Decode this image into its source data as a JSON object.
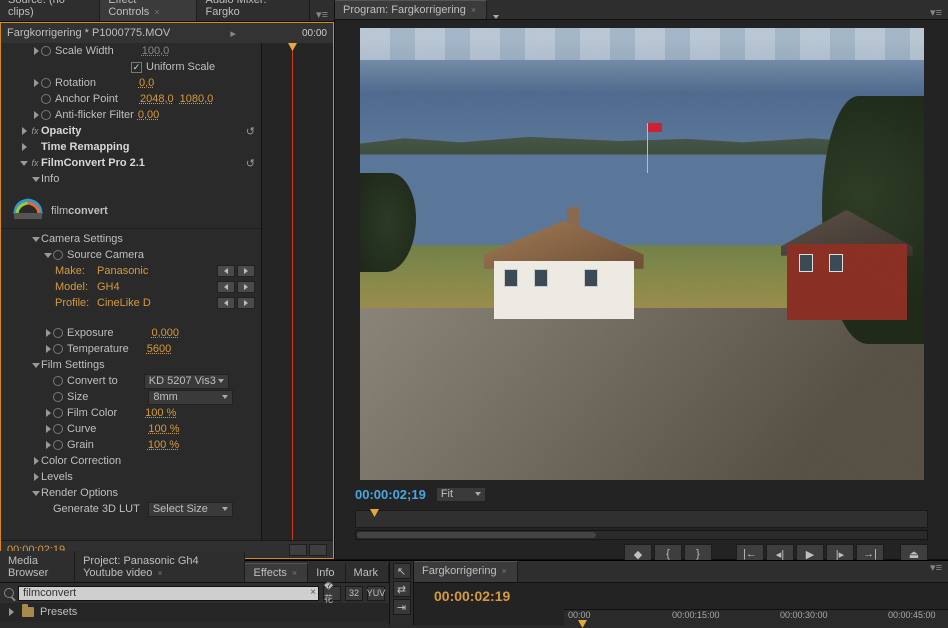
{
  "left_tabs": {
    "source": "Source: (no clips)",
    "effect_controls": "Effect Controls",
    "audio_mixer": "Audio Mixer: Fargko"
  },
  "ec": {
    "clip_title": "Fargkorrigering * P1000775.MOV",
    "head_tc": "00:00",
    "scale_width_label": "Scale Width",
    "scale_width_val": "100,0",
    "uniform_label": "Uniform Scale",
    "rotation_label": "Rotation",
    "rotation_val": "0,0",
    "anchor_label": "Anchor Point",
    "anchor_x": "2048,0",
    "anchor_y": "1080,0",
    "antiflicker_label": "Anti-flicker Filter",
    "antiflicker_val": "0,00",
    "opacity_label": "Opacity",
    "timeremap_label": "Time Remapping",
    "fc_label": "FilmConvert Pro 2.1",
    "info_label": "Info",
    "logo_a": "film",
    "logo_b": "convert",
    "cam_settings": "Camera Settings",
    "src_cam": "Source Camera",
    "make_l": "Make:",
    "make_v": "Panasonic",
    "model_l": "Model:",
    "model_v": "GH4",
    "profile_l": "Profile:",
    "profile_v": "CineLike D",
    "exposure_l": "Exposure",
    "exposure_v": "0,000",
    "temperature_l": "Temperature",
    "temperature_v": "5600",
    "film_settings": "Film Settings",
    "convert_l": "Convert to",
    "convert_v": "KD 5207 Vis3",
    "size_l": "Size",
    "size_v": "8mm",
    "filmcolor_l": "Film Color",
    "filmcolor_v": "100 %",
    "curve_l": "Curve",
    "curve_v": "100 %",
    "grain_l": "Grain",
    "grain_v": "100 %",
    "colorcorr": "Color Correction",
    "levels": "Levels",
    "render_opts": "Render Options",
    "genlut_l": "Generate 3D LUT",
    "genlut_v": "Select Size",
    "foot_tc": "00:00:02:19"
  },
  "program": {
    "tab": "Program: Fargkorrigering",
    "tc": "00:00:02;19",
    "fit": "Fit"
  },
  "bottom_tabs": {
    "media": "Media Browser",
    "project": "Project: Panasonic Gh4 Youtube video",
    "effects": "Effects",
    "info": "Info",
    "marker": "Mark"
  },
  "search": {
    "value": "filmconvert",
    "btn32": "32",
    "btnYUV": "YUV"
  },
  "presets": "Presets",
  "timeline": {
    "tab": "Fargkorrigering",
    "tc": "00:00:02:19",
    "ticks": [
      "00:00",
      "00:00:15:00",
      "00:00:30:00",
      "00:00:45:00"
    ]
  }
}
